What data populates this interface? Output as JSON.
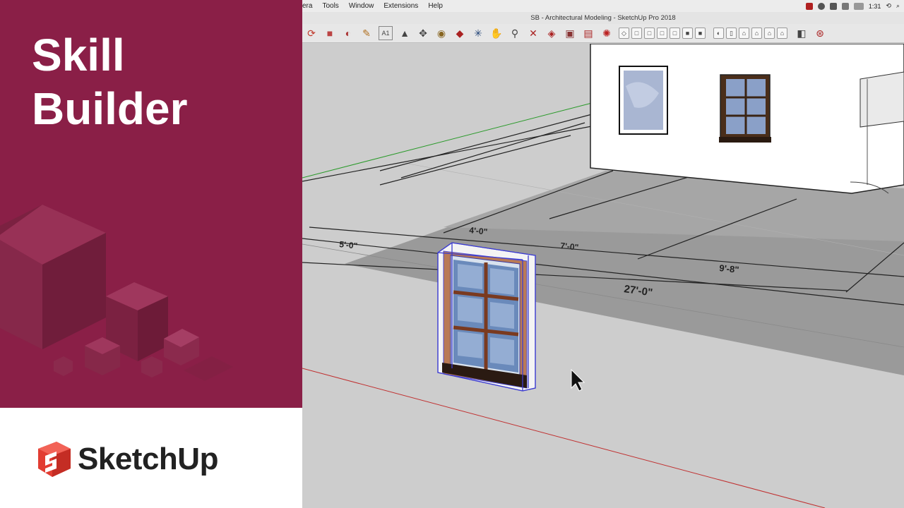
{
  "promo": {
    "title_line1": "Skill",
    "title_line2": "Builder",
    "brand": "SketchUp",
    "colors": {
      "panel": "#8a1f47",
      "logo_red": "#e23d32"
    }
  },
  "app": {
    "menu": [
      "era",
      "Tools",
      "Window",
      "Extensions",
      "Help"
    ],
    "clock": "1:31",
    "window_title": "SB - Architectural Modeling - SketchUp Pro 2018",
    "toolbar_icons": [
      "orbit-icon",
      "paint-icon",
      "rotate-icon",
      "tape-icon",
      "text-icon",
      "axes-icon",
      "move-icon",
      "pushpull-icon",
      "follow-me-icon",
      "intersect-icon",
      "zoom-icon",
      "zoom-extents-icon",
      "scale-icon",
      "section-icon",
      "warehouse-icon",
      "extension-icon"
    ],
    "viewport": {
      "dimensions": [
        "5'-0\"",
        "4'-0\"",
        "7'-0\"",
        "9'-8\"",
        "27'-0\""
      ]
    }
  }
}
